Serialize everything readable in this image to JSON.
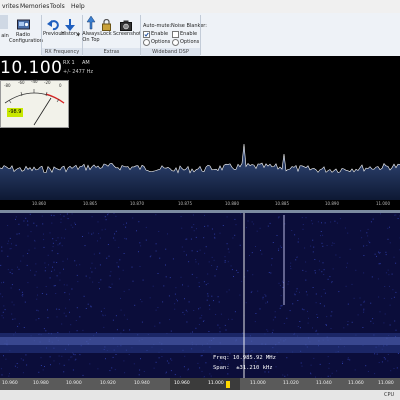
{
  "menu": {
    "items": [
      "vrites",
      "Memories",
      "Tools",
      "Help"
    ]
  },
  "ribbon": {
    "buttons": {
      "gain": "ain",
      "radio_config": "Radio Configuration",
      "previous": "Previous",
      "history": "History",
      "always_on_top": "Always On Top",
      "lock": "Lock",
      "screenshot": "Screenshot"
    },
    "auto_mute": {
      "label": "Auto-mute:",
      "enable": "Enable",
      "options": "Options",
      "enabled": true
    },
    "noise_blanker": {
      "label": "Noise Blanker:",
      "enable": "Enable",
      "options": "Options",
      "enabled": false
    },
    "groups": {
      "rx_frequency": "RX Frequency",
      "extras": "Extras",
      "wideband_dsp": "Wideband DSP"
    }
  },
  "frequency": {
    "main": "10.100",
    "rx": "RX 1",
    "mode": "AM",
    "offset": "+/- 2477 Hz"
  },
  "smeter": {
    "reading": "-98.9",
    "scale": [
      "-80",
      "-60",
      "-40",
      "-20",
      "0"
    ]
  },
  "spectrum": {
    "ticks": [
      "10.860",
      "10.865",
      "10.870",
      "10.875",
      "10.880",
      "10.885",
      "10.890",
      "10.895",
      "11.000"
    ]
  },
  "waterfall": {
    "tooltip": {
      "freq_label": "Freq:",
      "freq_value": "10.985.92 MHz",
      "span_label": "Span:",
      "span_value": "±31.210 kHz"
    }
  },
  "bottom_axis": {
    "ticks": [
      "10.960",
      "10.980",
      "10.900",
      "10.920",
      "10.940",
      "10.960",
      "11.000",
      "11.000",
      "11.020",
      "11.040",
      "11.060",
      "11.080"
    ]
  },
  "status": {
    "cpu": "CPU"
  },
  "colors": {
    "freq_text": "#ffffff",
    "spectrum_line": "#ffffff",
    "waterfall_bg": "#0b0d3a",
    "accent": "#ffd800"
  }
}
